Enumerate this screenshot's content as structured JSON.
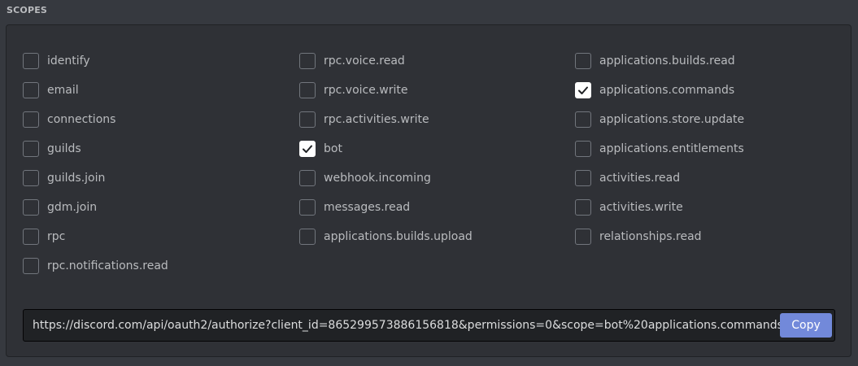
{
  "section_title": "SCOPES",
  "scopes": {
    "col1": [
      {
        "label": "identify",
        "checked": false
      },
      {
        "label": "email",
        "checked": false
      },
      {
        "label": "connections",
        "checked": false
      },
      {
        "label": "guilds",
        "checked": false
      },
      {
        "label": "guilds.join",
        "checked": false
      },
      {
        "label": "gdm.join",
        "checked": false
      },
      {
        "label": "rpc",
        "checked": false
      },
      {
        "label": "rpc.notifications.read",
        "checked": false
      }
    ],
    "col2": [
      {
        "label": "rpc.voice.read",
        "checked": false
      },
      {
        "label": "rpc.voice.write",
        "checked": false
      },
      {
        "label": "rpc.activities.write",
        "checked": false
      },
      {
        "label": "bot",
        "checked": true
      },
      {
        "label": "webhook.incoming",
        "checked": false
      },
      {
        "label": "messages.read",
        "checked": false
      },
      {
        "label": "applications.builds.upload",
        "checked": false
      }
    ],
    "col3": [
      {
        "label": "applications.builds.read",
        "checked": false
      },
      {
        "label": "applications.commands",
        "checked": true
      },
      {
        "label": "applications.store.update",
        "checked": false
      },
      {
        "label": "applications.entitlements",
        "checked": false
      },
      {
        "label": "activities.read",
        "checked": false
      },
      {
        "label": "activities.write",
        "checked": false
      },
      {
        "label": "relationships.read",
        "checked": false
      }
    ]
  },
  "generated_url": {
    "value": "https://discord.com/api/oauth2/authorize?client_id=865299573886156818&permissions=0&scope=bot%20applications.commands",
    "copy_label": "Copy"
  },
  "icons": {
    "checkmark": "check-icon"
  },
  "colors": {
    "background": "#36393f",
    "panel": "#2f3136",
    "accent": "#7289da",
    "checked_fill": "#ffffff",
    "check_mark": "#202225"
  }
}
